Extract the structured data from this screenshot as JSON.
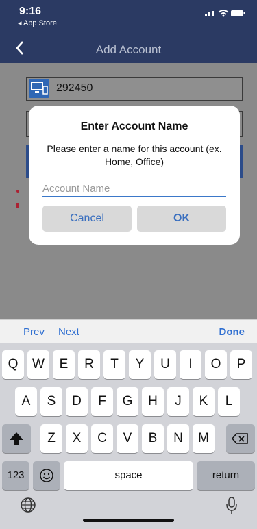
{
  "status": {
    "time": "9:16",
    "back_app": "◂ App Store"
  },
  "nav": {
    "title": "Add Account",
    "back_icon": "chevron-left-icon"
  },
  "background": {
    "account_number": "292450"
  },
  "dialog": {
    "title": "Enter Account Name",
    "message": "Please enter a name for this account (ex. Home, Office)",
    "input_placeholder": "Account Name",
    "input_value": "",
    "cancel_label": "Cancel",
    "ok_label": "OK"
  },
  "accessory": {
    "prev_label": "Prev",
    "next_label": "Next",
    "done_label": "Done"
  },
  "keyboard": {
    "row1": [
      "Q",
      "W",
      "E",
      "R",
      "T",
      "Y",
      "U",
      "I",
      "O",
      "P"
    ],
    "row2": [
      "A",
      "S",
      "D",
      "F",
      "G",
      "H",
      "J",
      "K",
      "L"
    ],
    "row3": [
      "Z",
      "X",
      "C",
      "V",
      "B",
      "N",
      "M"
    ],
    "numbers_label": "123",
    "space_label": "space",
    "return_label": "return"
  }
}
